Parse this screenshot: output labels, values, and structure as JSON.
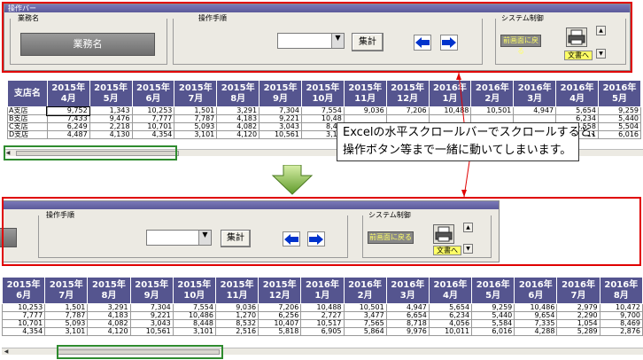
{
  "toolbar": {
    "title": "操作バー",
    "gyomu_label": "業務名",
    "gyomu_button": "業務名",
    "sousa_label": "操作手順",
    "shukei_button": "集計",
    "system_label": "システム制御",
    "return_button": "前画面に戻る",
    "export_label": "文書へ"
  },
  "table_top": {
    "corner_header": "支店名",
    "headers": [
      [
        "2015年",
        "4月"
      ],
      [
        "2015年",
        "5月"
      ],
      [
        "2015年",
        "6月"
      ],
      [
        "2015年",
        "7月"
      ],
      [
        "2015年",
        "8月"
      ],
      [
        "2015年",
        "9月"
      ],
      [
        "2015年",
        "10月"
      ],
      [
        "2015年",
        "11月"
      ],
      [
        "2015年",
        "12月"
      ],
      [
        "2016年",
        "1月"
      ],
      [
        "2016年",
        "2月"
      ],
      [
        "2016年",
        "3月"
      ],
      [
        "2016年",
        "4月"
      ],
      [
        "2016年",
        "5月"
      ]
    ],
    "rows": [
      {
        "name": "A支店",
        "values": [
          "9,752",
          "1,343",
          "10,253",
          "1,501",
          "3,291",
          "7,304",
          "7,554",
          "9,036",
          "7,206",
          "10,488",
          "10,501",
          "4,947",
          "5,654",
          "9,259"
        ]
      },
      {
        "name": "B支店",
        "values": [
          "7,433",
          "9,476",
          "7,777",
          "7,787",
          "4,183",
          "9,221",
          "10,48",
          "",
          "",
          "",
          "",
          "",
          "6,234",
          "5,440"
        ]
      },
      {
        "name": "C支店",
        "values": [
          "6,249",
          "2,218",
          "10,701",
          "5,093",
          "4,082",
          "3,043",
          "8,44",
          "",
          "",
          "",
          "",
          "",
          "5,558",
          "5,504"
        ]
      },
      {
        "name": "D支店",
        "values": [
          "4,487",
          "4,130",
          "4,354",
          "3,101",
          "4,120",
          "10,561",
          "3,10",
          "",
          "",
          "",
          "",
          "",
          "11",
          "6,016"
        ]
      }
    ]
  },
  "table_bottom": {
    "headers": [
      [
        "2015年",
        "6月"
      ],
      [
        "2015年",
        "7月"
      ],
      [
        "2015年",
        "8月"
      ],
      [
        "2015年",
        "9月"
      ],
      [
        "2015年",
        "10月"
      ],
      [
        "2015年",
        "11月"
      ],
      [
        "2015年",
        "12月"
      ],
      [
        "2016年",
        "1月"
      ],
      [
        "2016年",
        "2月"
      ],
      [
        "2016年",
        "3月"
      ],
      [
        "2016年",
        "4月"
      ],
      [
        "2016年",
        "5月"
      ],
      [
        "2016年",
        "6月"
      ],
      [
        "2016年",
        "7月"
      ],
      [
        "2016年",
        "8月"
      ]
    ],
    "rows": [
      [
        "10,253",
        "1,501",
        "3,291",
        "7,304",
        "7,554",
        "9,036",
        "7,206",
        "10,488",
        "10,501",
        "4,947",
        "5,654",
        "9,259",
        "10,486",
        "2,979",
        "10,472"
      ],
      [
        "7,777",
        "7,787",
        "4,183",
        "9,221",
        "10,486",
        "1,270",
        "6,256",
        "2,727",
        "3,477",
        "6,654",
        "6,234",
        "5,440",
        "9,654",
        "2,290",
        "9,700"
      ],
      [
        "10,701",
        "5,093",
        "4,082",
        "3,043",
        "8,448",
        "8,532",
        "10,407",
        "10,517",
        "7,565",
        "8,718",
        "4,056",
        "5,584",
        "7,335",
        "1,054",
        "8,469"
      ],
      [
        "4,354",
        "3,101",
        "4,120",
        "10,561",
        "3,101",
        "2,516",
        "5,818",
        "6,905",
        "5,864",
        "9,976",
        "10,011",
        "6,016",
        "4,288",
        "5,289",
        "2,876"
      ]
    ]
  },
  "callout": {
    "line1": "Excelの水平スクロールバーでスクロールすると、",
    "line2": "操作ボタン等まで一緒に動いてしまいます。"
  },
  "colors": {
    "header_bg": "#55558f",
    "red_frame": "#e00000",
    "green_frame": "#2e8b2e",
    "arrow_blue": "#0033cc",
    "return_text": "#ffff66"
  }
}
